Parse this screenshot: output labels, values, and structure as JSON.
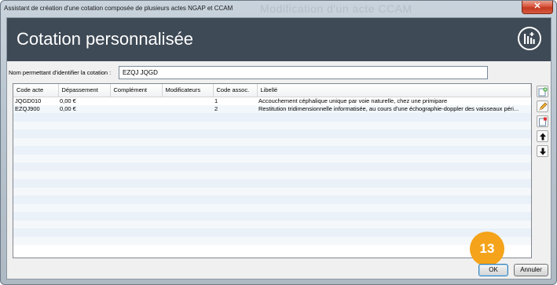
{
  "window": {
    "title": "Assistant de création d'une cotation composée de plusieurs actes NGAP et CCAM",
    "ghost_title": "Modification d'un acte CCAM",
    "close_label": "✕"
  },
  "banner": {
    "heading": "Cotation personnalisée",
    "logo_icon": "medical-app-logo-icon"
  },
  "name_field": {
    "label": "Nom permettant d'identifier la cotation :",
    "value": "EZQJ JQGD"
  },
  "table": {
    "columns": [
      "Code acte",
      "Dépassement",
      "Complément",
      "Modificateurs",
      "Code assoc.",
      "Libellé"
    ],
    "rows": [
      {
        "code_acte": "JQGD010",
        "depassement": "0,00 €",
        "complement": "",
        "modificateurs": "",
        "code_assoc": "1",
        "libelle": "Accouchement céphalique unique par voie naturelle, chez une primipare"
      },
      {
        "code_acte": "EZQJ900",
        "depassement": "0,00 €",
        "complement": "",
        "modificateurs": "",
        "code_assoc": "2",
        "libelle": "Restitution tridimensionnelle informatisée, au cours d'une échographie-doppler des vaisseaux péri..."
      }
    ]
  },
  "side_tools": [
    "add-icon",
    "edit-pencil-icon",
    "delete-icon",
    "arrow-up-icon",
    "arrow-down-icon"
  ],
  "badge": {
    "number": "13"
  },
  "buttons": {
    "ok": "OK",
    "cancel": "Annuler"
  },
  "colors": {
    "banner": "#3e4a56",
    "badge": "#f5a31a"
  }
}
